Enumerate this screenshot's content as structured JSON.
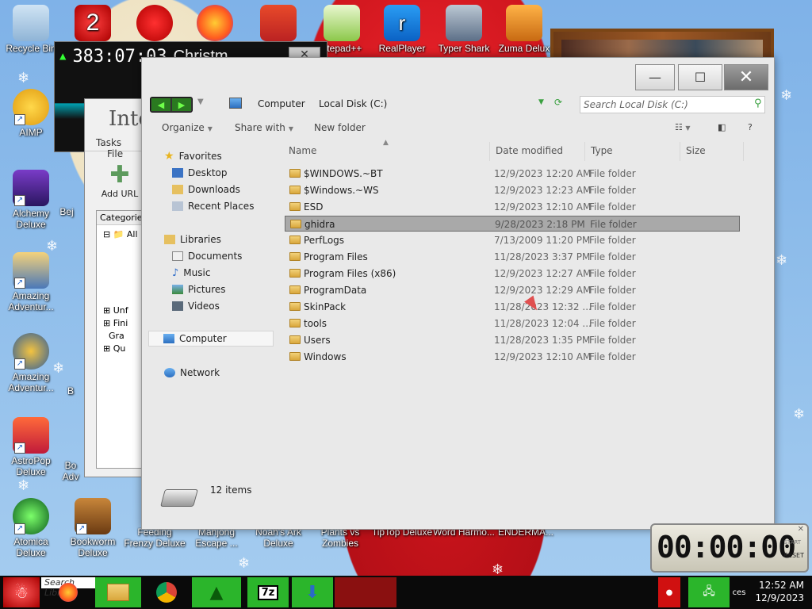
{
  "desktop": {
    "icons": [
      {
        "label": "Recycle Bin",
        "icon": "recycle-bin-icon"
      },
      {
        "label": "2",
        "icon": "app-2-icon"
      },
      {
        "label": "",
        "icon": "red-creature-icon"
      },
      {
        "label": "",
        "icon": "firefox-icon"
      },
      {
        "label": "",
        "icon": "shrine-gate-icon"
      },
      {
        "label": "otepad++",
        "icon": "notepadpp-icon"
      },
      {
        "label": "RealPlayer",
        "icon": "realplayer-icon"
      },
      {
        "label": "Typer Shark",
        "icon": "typer-shark-icon"
      },
      {
        "label": "Zuma Delux",
        "icon": "zuma-icon"
      },
      {
        "label": "AIMP",
        "icon": "aimp-icon"
      },
      {
        "label": "Alchemy Deluxe",
        "icon": "alchemy-icon"
      },
      {
        "label": "Amazing Adventur...",
        "icon": "amazing-adventures-icon"
      },
      {
        "label": "Amazing Adventur...",
        "icon": "amazing-adventures-2-icon"
      },
      {
        "label": "AstroPop Deluxe",
        "icon": "astropop-icon"
      },
      {
        "label": "Atomica Deluxe",
        "icon": "atomica-icon"
      },
      {
        "label": "Bookworm Deluxe",
        "icon": "bookworm-icon"
      },
      {
        "label": "Feeding Frenzy Deluxe",
        "icon": "feeding-frenzy-icon"
      },
      {
        "label": "Mahjong Escape ...",
        "icon": "mahjong-icon"
      },
      {
        "label": "Noah's Ark Deluxe",
        "icon": "noahs-ark-icon"
      },
      {
        "label": "Plants vs Zombies",
        "icon": "plants-vs-zombies-icon"
      },
      {
        "label": "TipTop Deluxe",
        "icon": "tiptop-icon"
      },
      {
        "label": "Word Harmo...",
        "icon": "word-harmony-icon"
      },
      {
        "label": "ENDERMA...",
        "icon": "enderman-icon"
      },
      {
        "label": "Bej",
        "icon": "bejeweled-icon"
      },
      {
        "label": "B",
        "icon": "partial-b-icon"
      },
      {
        "label": "Bo",
        "icon": "partial-bo-icon"
      },
      {
        "label": "Adv",
        "icon": "partial-adv-icon"
      },
      {
        "label": "D",
        "icon": "partial-d-icon"
      }
    ]
  },
  "timer_window": {
    "countdown": "383:07:03",
    "title_fragment": "Christm"
  },
  "idm_window": {
    "title": "Inte",
    "menu": [
      "Tasks",
      "File"
    ],
    "add_url": "Add URL",
    "categories_header": "Categories",
    "tree": [
      "All",
      "Unf",
      "Fini",
      "Gra",
      "Qu"
    ]
  },
  "explorer": {
    "window_buttons": {
      "minimize": "—",
      "maximize": "☐",
      "close": "✕"
    },
    "breadcrumb": [
      "Computer",
      "Local Disk (C:)"
    ],
    "search_placeholder": "Search Local Disk (C:)",
    "commands": {
      "organize": "Organize",
      "share_with": "Share with",
      "new_folder": "New folder"
    },
    "nav": {
      "favorites": "Favorites",
      "desktop": "Desktop",
      "downloads": "Downloads",
      "recent_places": "Recent Places",
      "libraries": "Libraries",
      "documents": "Documents",
      "music": "Music",
      "pictures": "Pictures",
      "videos": "Videos",
      "computer": "Computer",
      "network": "Network"
    },
    "columns": {
      "name": "Name",
      "date_modified": "Date modified",
      "type": "Type",
      "size": "Size"
    },
    "rows": [
      {
        "name": "$WINDOWS.~BT",
        "date": "12/9/2023 12:20 AM",
        "type": "File folder"
      },
      {
        "name": "$Windows.~WS",
        "date": "12/9/2023 12:23 AM",
        "type": "File folder"
      },
      {
        "name": "ESD",
        "date": "12/9/2023 12:10 AM",
        "type": "File folder"
      },
      {
        "name": "ghidra",
        "date": "9/28/2023 2:18 PM",
        "type": "File folder"
      },
      {
        "name": "PerfLogs",
        "date": "7/13/2009 11:20 PM",
        "type": "File folder"
      },
      {
        "name": "Program Files",
        "date": "11/28/2023 3:37 PM",
        "type": "File folder"
      },
      {
        "name": "Program Files (x86)",
        "date": "12/9/2023 12:27 AM",
        "type": "File folder"
      },
      {
        "name": "ProgramData",
        "date": "12/9/2023 12:29 AM",
        "type": "File folder"
      },
      {
        "name": "SkinPack",
        "date": "11/28/2023 12:32 ...",
        "type": "File folder"
      },
      {
        "name": "tools",
        "date": "11/28/2023 12:04 ...",
        "type": "File folder"
      },
      {
        "name": "Users",
        "date": "11/28/2023 1:35 PM",
        "type": "File folder"
      },
      {
        "name": "Windows",
        "date": "12/9/2023 12:10 AM",
        "type": "File folder"
      }
    ],
    "selected_row": "ghidra",
    "status": "12 items"
  },
  "stopwatch": {
    "display": "00:00:00",
    "start_label": "START",
    "reset_label": "RESET",
    "close": "✕"
  },
  "taskbar": {
    "search_placeholder": "Search Libra",
    "time": "12:52 AM",
    "date": "12/9/2023",
    "tray_fragment": "ces"
  }
}
